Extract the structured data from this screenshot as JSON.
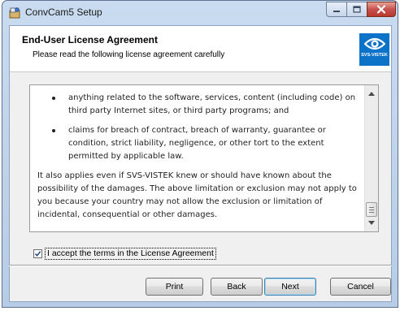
{
  "window": {
    "title": "ConvCam5 Setup"
  },
  "banner": {
    "title": "End-User License Agreement",
    "subtitle": "Please read the following license agreement carefully",
    "logo_text": "SVS-VISTEK"
  },
  "license": {
    "bullets": [
      "anything related to the software, services, content (including code) on third party Internet sites, or third party programs; and",
      "claims for breach of contract, breach of warranty, guarantee or condition, strict liability, negligence, or other tort to the extent permitted by applicable law."
    ],
    "paragraph": "It also applies even if SVS-VISTEK knew or should have known about the possibility of the damages. The above limitation or exclusion may not apply to you because your country may not allow the exclusion or limitation of incidental, consequential or other damages."
  },
  "accept": {
    "label": "I accept the terms in the License Agreement",
    "checked": true
  },
  "buttons": {
    "print": "Print",
    "back": "Back",
    "next": "Next",
    "cancel": "Cancel"
  },
  "colors": {
    "accent": "#0d73c9",
    "close_button": "#c75050"
  },
  "icons": [
    "setup-app-icon",
    "minimize-icon",
    "maximize-icon",
    "close-icon",
    "svs-vistek-logo",
    "scroll-up-arrow-icon",
    "scroll-down-arrow-icon",
    "checkmark-icon"
  ]
}
